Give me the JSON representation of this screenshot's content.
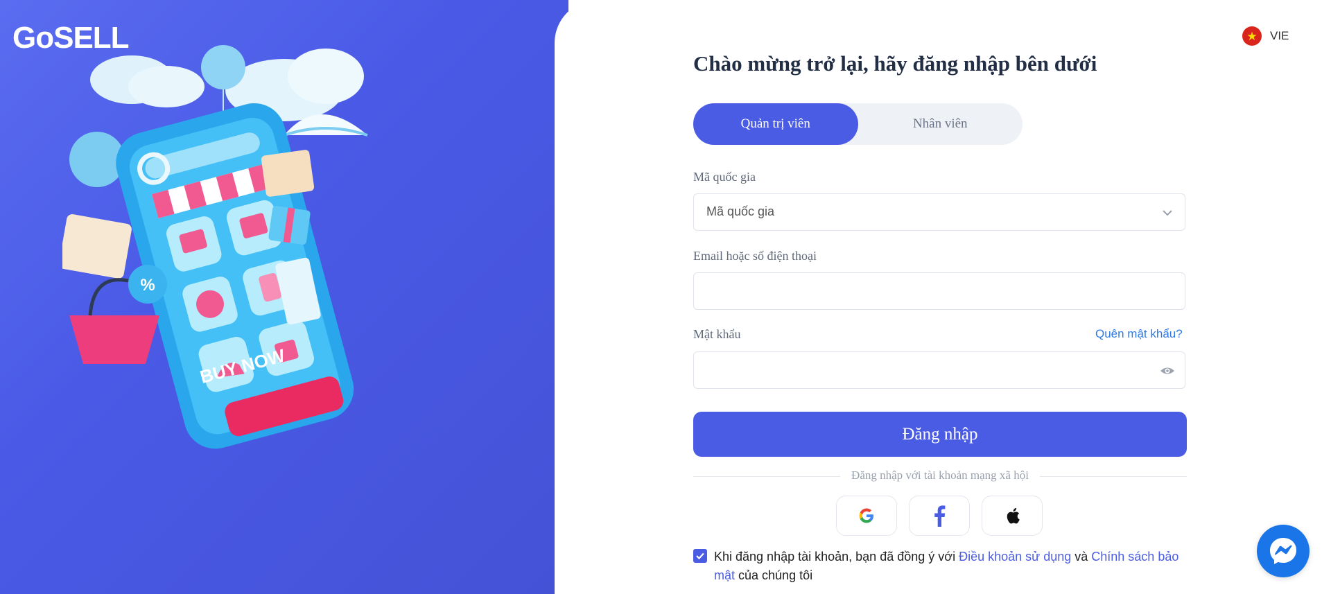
{
  "brand": {
    "logo_text": "GoSELL"
  },
  "language": {
    "code": "VIE",
    "flag_icon": "vietnam-flag-icon"
  },
  "login": {
    "title": "Chào mừng trở lại, hãy đăng nhập bên dưới",
    "tabs": [
      {
        "label": "Quản trị viên",
        "active": true
      },
      {
        "label": "Nhân viên",
        "active": false
      }
    ],
    "country_code": {
      "label": "Mã quốc gia",
      "placeholder": "Mã quốc gia"
    },
    "email": {
      "label": "Email hoặc số điện thoại",
      "value": ""
    },
    "password": {
      "label": "Mật khẩu",
      "value": "",
      "forgot_label": "Quên mật khẩu?"
    },
    "submit_label": "Đăng nhập",
    "social_divider": "Đăng nhập với tài khoản mạng xã hội",
    "social": [
      "google-icon",
      "facebook-icon",
      "apple-icon"
    ],
    "terms": {
      "checked": true,
      "prefix": "Khi đăng nhập tài khoản, bạn đã đồng ý với ",
      "terms_link": "Điều khoản sử dụng",
      "and": " và ",
      "privacy_link": "Chính sách bảo mật",
      "suffix": " của chúng tôi"
    }
  },
  "illustration": {
    "banner_text": "BUY NOW"
  },
  "colors": {
    "primary": "#4b5ce4",
    "link": "#2f7ae5",
    "background_left": "#4a5ae6"
  }
}
